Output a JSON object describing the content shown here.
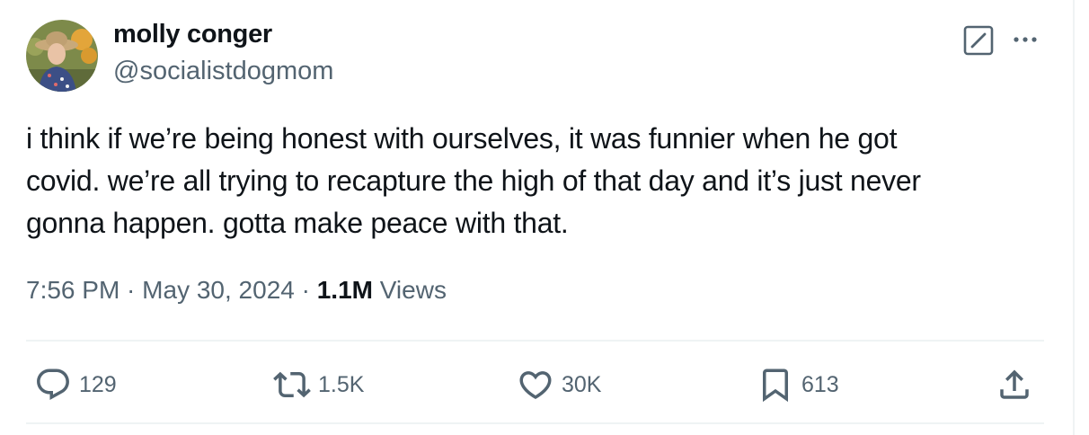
{
  "author": {
    "name": "molly conger",
    "handle": "@socialistdogmom"
  },
  "tweet": {
    "text": "i think if we’re being honest with ourselves, it was funnier when he got\ncovid. we’re all trying to recapture the high of that day and it’s just never\ngonna happen. gotta make peace with that."
  },
  "meta": {
    "time": "7:56 PM",
    "separator": " · ",
    "date": "May 30, 2024",
    "views_count": "1.1M",
    "views_label": " Views"
  },
  "actions": {
    "replies": "129",
    "reposts": "1.5K",
    "likes": "30K",
    "bookmarks": "613"
  },
  "icons": {
    "grok": "grok-icon",
    "more": "more-dots-icon",
    "reply": "reply-icon",
    "repost": "repost-icon",
    "like": "heart-icon",
    "bookmark": "bookmark-icon",
    "share": "share-icon"
  },
  "colors": {
    "text_primary": "#0f1419",
    "text_secondary": "#536471",
    "divider": "#eff3f4"
  }
}
